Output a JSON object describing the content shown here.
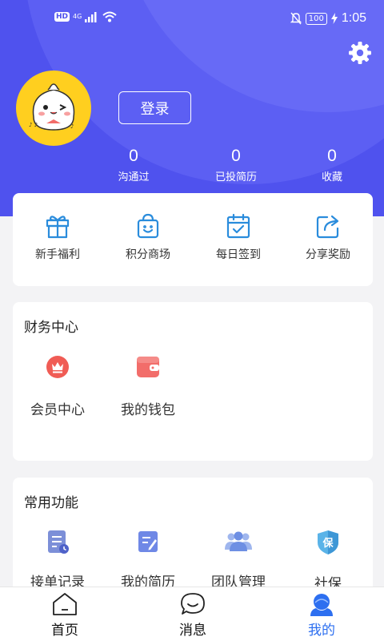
{
  "status_bar": {
    "hd": "HD",
    "network": "4G",
    "battery": "100",
    "time": "1:05"
  },
  "header": {
    "login_label": "登录",
    "stats": [
      {
        "value": "0",
        "label": "沟通过"
      },
      {
        "value": "0",
        "label": "已投简历"
      },
      {
        "value": "0",
        "label": "收藏"
      }
    ]
  },
  "quick_actions": [
    {
      "label": "新手福利",
      "icon": "gift-icon"
    },
    {
      "label": "积分商场",
      "icon": "shopping-bag-icon"
    },
    {
      "label": "每日签到",
      "icon": "calendar-check-icon"
    },
    {
      "label": "分享奖励",
      "icon": "share-icon"
    }
  ],
  "finance": {
    "title": "财务中心",
    "items": [
      {
        "label": "会员中心",
        "icon": "crown-icon"
      },
      {
        "label": "我的钱包",
        "icon": "wallet-icon"
      }
    ]
  },
  "common": {
    "title": "常用功能",
    "items": [
      {
        "label": "接单记录",
        "icon": "order-record-icon"
      },
      {
        "label": "我的简历",
        "icon": "resume-icon"
      },
      {
        "label": "团队管理",
        "icon": "team-icon"
      },
      {
        "label": "社保",
        "icon": "shield-icon"
      }
    ]
  },
  "tabs": [
    {
      "label": "首页",
      "icon": "home-icon",
      "active": false
    },
    {
      "label": "消息",
      "icon": "message-icon",
      "active": false
    },
    {
      "label": "我的",
      "icon": "profile-icon",
      "active": true
    }
  ],
  "colors": {
    "brand": "#4f52ee",
    "accent_blue": "#2d6ff0",
    "icon_blue": "#2a8cdc",
    "crown_red": "#f05c55",
    "wallet_red": "#f26d6a"
  }
}
